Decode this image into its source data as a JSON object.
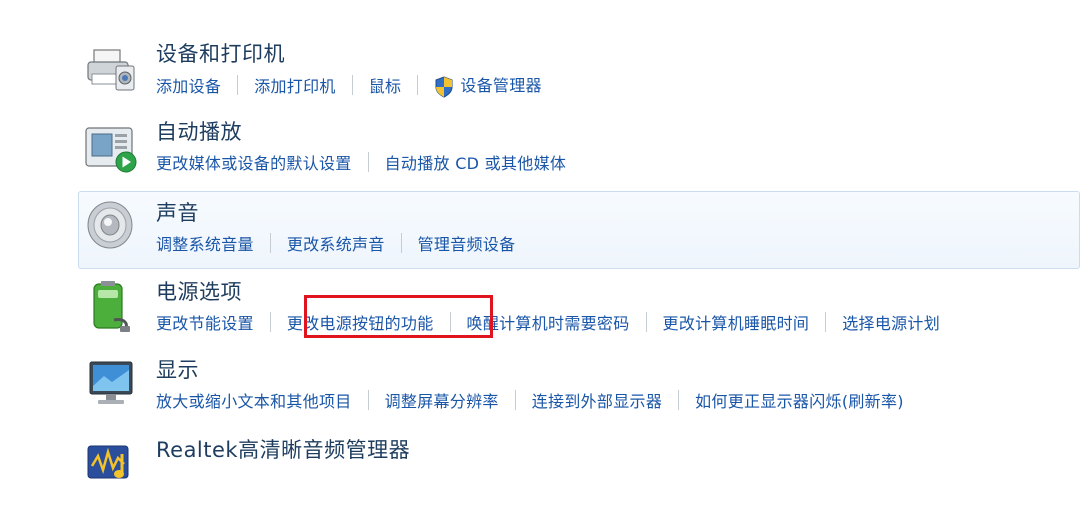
{
  "sections": [
    {
      "title": "设备和打印机",
      "icon": "printer-icon",
      "links": [
        "添加设备",
        "添加打印机",
        "鼠标",
        "设备管理器"
      ]
    },
    {
      "title": "自动播放",
      "icon": "autoplay-icon",
      "links": [
        "更改媒体或设备的默认设置",
        "自动播放 CD 或其他媒体"
      ]
    },
    {
      "title": "声音",
      "icon": "speaker-icon",
      "links": [
        "调整系统音量",
        "更改系统声音",
        "管理音频设备"
      ]
    },
    {
      "title": "电源选项",
      "icon": "battery-power-icon",
      "links": [
        "更改节能设置",
        "更改电源按钮的功能",
        "唤醒计算机时需要密码",
        "更改计算机睡眠时间",
        "选择电源计划"
      ]
    },
    {
      "title": "显示",
      "icon": "display-monitor-icon",
      "links": [
        "放大或缩小文本和其他项目",
        "调整屏幕分辨率",
        "连接到外部显示器",
        "如何更正显示器闪烁(刷新率)"
      ]
    },
    {
      "title": "Realtek高清晰音频管理器",
      "icon": "realtek-audio-icon",
      "links": []
    }
  ],
  "highlight": {
    "target": "更改电源按钮的功能",
    "color": "#e0141e"
  },
  "colors": {
    "link": "#1a56a8",
    "title": "#1e3d5e",
    "hover_bg": "#eef5fc"
  }
}
